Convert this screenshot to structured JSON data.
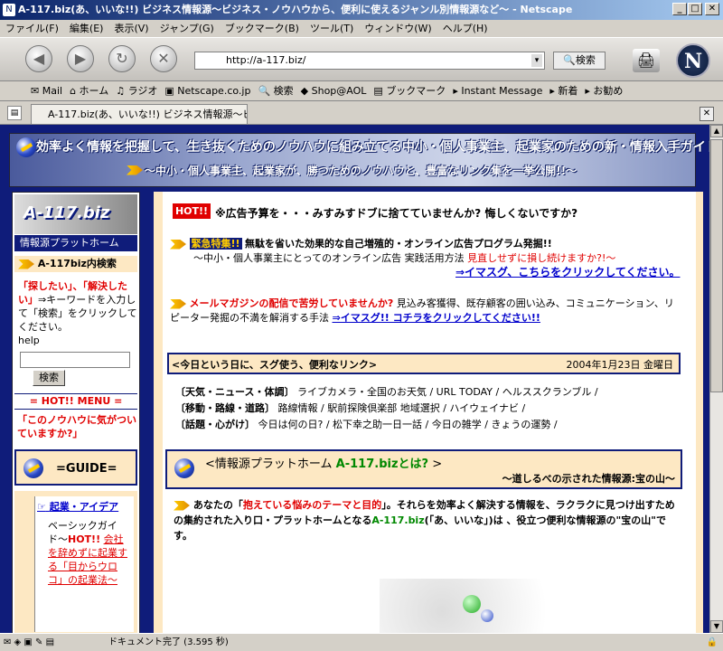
{
  "window": {
    "title": "A-117.biz(あ、いいな!!) ビジネス情報源〜ビジネス・ノウハウから、便利に使えるジャンル別情報源など〜 - Netscape"
  },
  "menu": [
    "ファイル(F)",
    "編集(E)",
    "表示(V)",
    "ジャンプ(G)",
    "ブックマーク(B)",
    "ツール(T)",
    "ウィンドウ(W)",
    "ヘルプ(H)"
  ],
  "navbar": {
    "url": "http://a-117.biz/",
    "search_label": "検索"
  },
  "personal_toolbar": [
    "Mail",
    "ホーム",
    "ラジオ",
    "Netscape.co.jp",
    "検索",
    "Shop@AOL",
    "ブックマーク",
    "Instant Message",
    "新着",
    "お勧め"
  ],
  "tab": {
    "label": "A-117.biz(あ、いいな!!) ビジネス情報源〜ビ..."
  },
  "banner": {
    "line1": "効率よく情報を把握して、生き抜くためのノウハウに組み立てる中小・個人事業主、起業家のための新・情報入手ガイド",
    "line2": "〜中小・個人事業主、起業家が、勝つためのノウハウと、豊富なリンク集を一挙公開!!〜"
  },
  "sidebar": {
    "logo": "A-117.biz",
    "platform": "情報源プラットホーム",
    "site_search_title": "A-117biz内検索",
    "search_desc_pre": "「探したい」、「解決したい」",
    "search_desc_post": "⇒キーワードを入力して「検索」をクリックしてください。",
    "help": "help",
    "search_button": "検索",
    "menu_title": "= HOT!! MENU =",
    "hot_question": "「このノウハウに気がついていますか?」",
    "guide": "=GUIDE=",
    "category": "起業・アイデア",
    "item_pre": "ベーシックガイド〜",
    "item_hot": "HOT!!",
    "item_mid": "会社を辞めずに起業する",
    "item_post": "「目からウロコ」の起業法〜"
  },
  "main": {
    "hot_badge": "HOT!!",
    "ad_question": "※広告予算を・・・みすみすドブに捨てていませんか? 悔しくないですか?",
    "special_label": "緊急特集!!",
    "special_text": "無駄を省いた効果的な自己増殖的・オンライン広告プログラム発掘!!",
    "special_sub": "〜中小・個人事業主にとってのオンライン広告 実践活用方法",
    "special_red": "見直しせずに損し続けますか?!〜",
    "special_link": "⇒イマスグ、こちらをクリックしてください。",
    "mail_q": "メールマガジンの配信で苦労していませんか?",
    "mail_text": "見込み客獲得、既存顧客の囲い込み、コミュニケーション、リピーター発掘の不満を解消する手法",
    "mail_link": "⇒イマスグ!! コチラをクリックしてください!!",
    "today_title": "<今日という日に、スグ使う、便利なリンク>",
    "today_date": "2004年1月23日 金曜日",
    "links": [
      {
        "label": "〔天気・ニュース・体調〕",
        "items": "ライブカメラ・全国のお天気 / URL TODAY / ヘルススクランブル /"
      },
      {
        "label": "〔移動・路線・道路〕",
        "items": "路線情報 / 駅前探険倶楽部 地域選択 / ハイウェイナビ /"
      },
      {
        "label": "〔話題・心がけ〕",
        "items": "今日は何の日? / 松下幸之助一日一話 / 今日の雑学 / きょうの運勢 /"
      }
    ],
    "platform_title_pre": "<情報源プラットホーム",
    "platform_title_mid": "A-117.bizとは?",
    "platform_title_post": ">",
    "platform_sub": "〜道しるべの示された情報源:宝の山〜",
    "desc_1": "あなたの「",
    "desc_red": "抱えている悩みのテーマと目的",
    "desc_2": "」。それらを効率よく解決する情報を、ラクラクに見つけ出すための集約された入り口・プラットホームとなる",
    "desc_site": "A-117.biz",
    "desc_3": "(「あ、いいな」)は 、役立つ便利な情報源の\"宝の山\"です。"
  },
  "status": {
    "text": "ドキュメント完了 (3.595 秒)"
  }
}
